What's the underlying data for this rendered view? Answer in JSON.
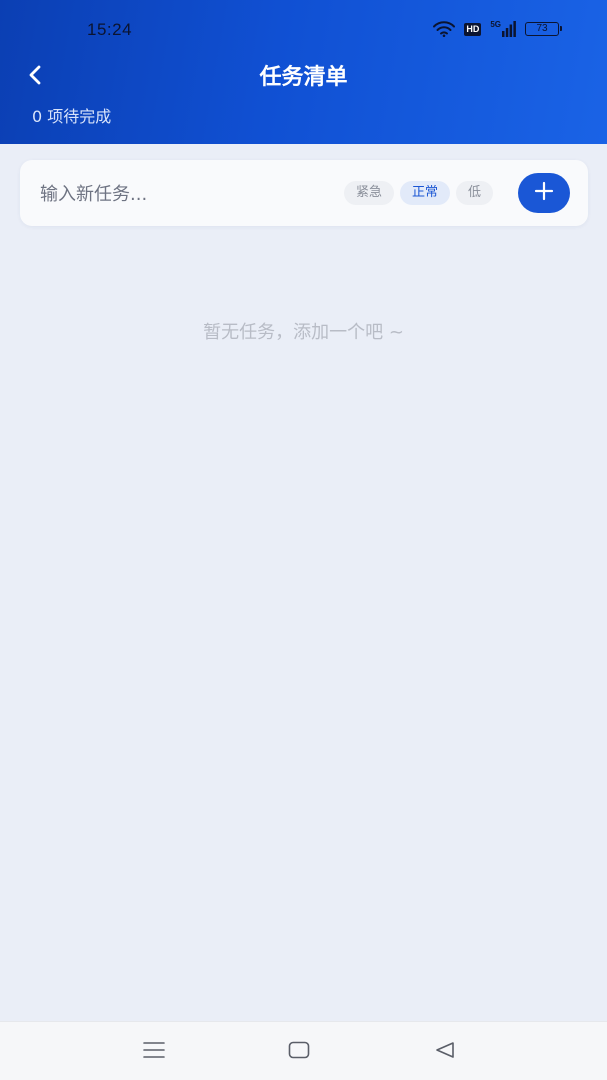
{
  "status_bar": {
    "time": "15:24",
    "hd_label": "HD",
    "network_label": "5G",
    "battery_level": "73",
    "icons": [
      "wifi-icon",
      "hd-icon",
      "signal-icon",
      "battery-icon"
    ]
  },
  "header": {
    "title": "任务清单",
    "pending_text": "0 项待完成",
    "back_icon": "chevron-left-icon"
  },
  "task_input": {
    "placeholder": "输入新任务...",
    "value": ""
  },
  "priority": {
    "options": [
      {
        "label": "紧急",
        "selected": false
      },
      {
        "label": "正常",
        "selected": true
      },
      {
        "label": "低",
        "selected": false
      }
    ]
  },
  "add_button": {
    "icon": "plus-icon"
  },
  "empty_state": {
    "text": "暂无任务，添加一个吧 ~"
  },
  "nav_bar": {
    "icons": [
      "menu-icon",
      "home-icon",
      "back-triangle-icon"
    ]
  },
  "colors": {
    "header_start": "#0b3fb3",
    "header_end": "#1a63e6",
    "accent": "#1a57d6",
    "background": "#eaeef7",
    "chip_active_bg": "#e2eaf9",
    "chip_active_text": "#1b56d4"
  }
}
